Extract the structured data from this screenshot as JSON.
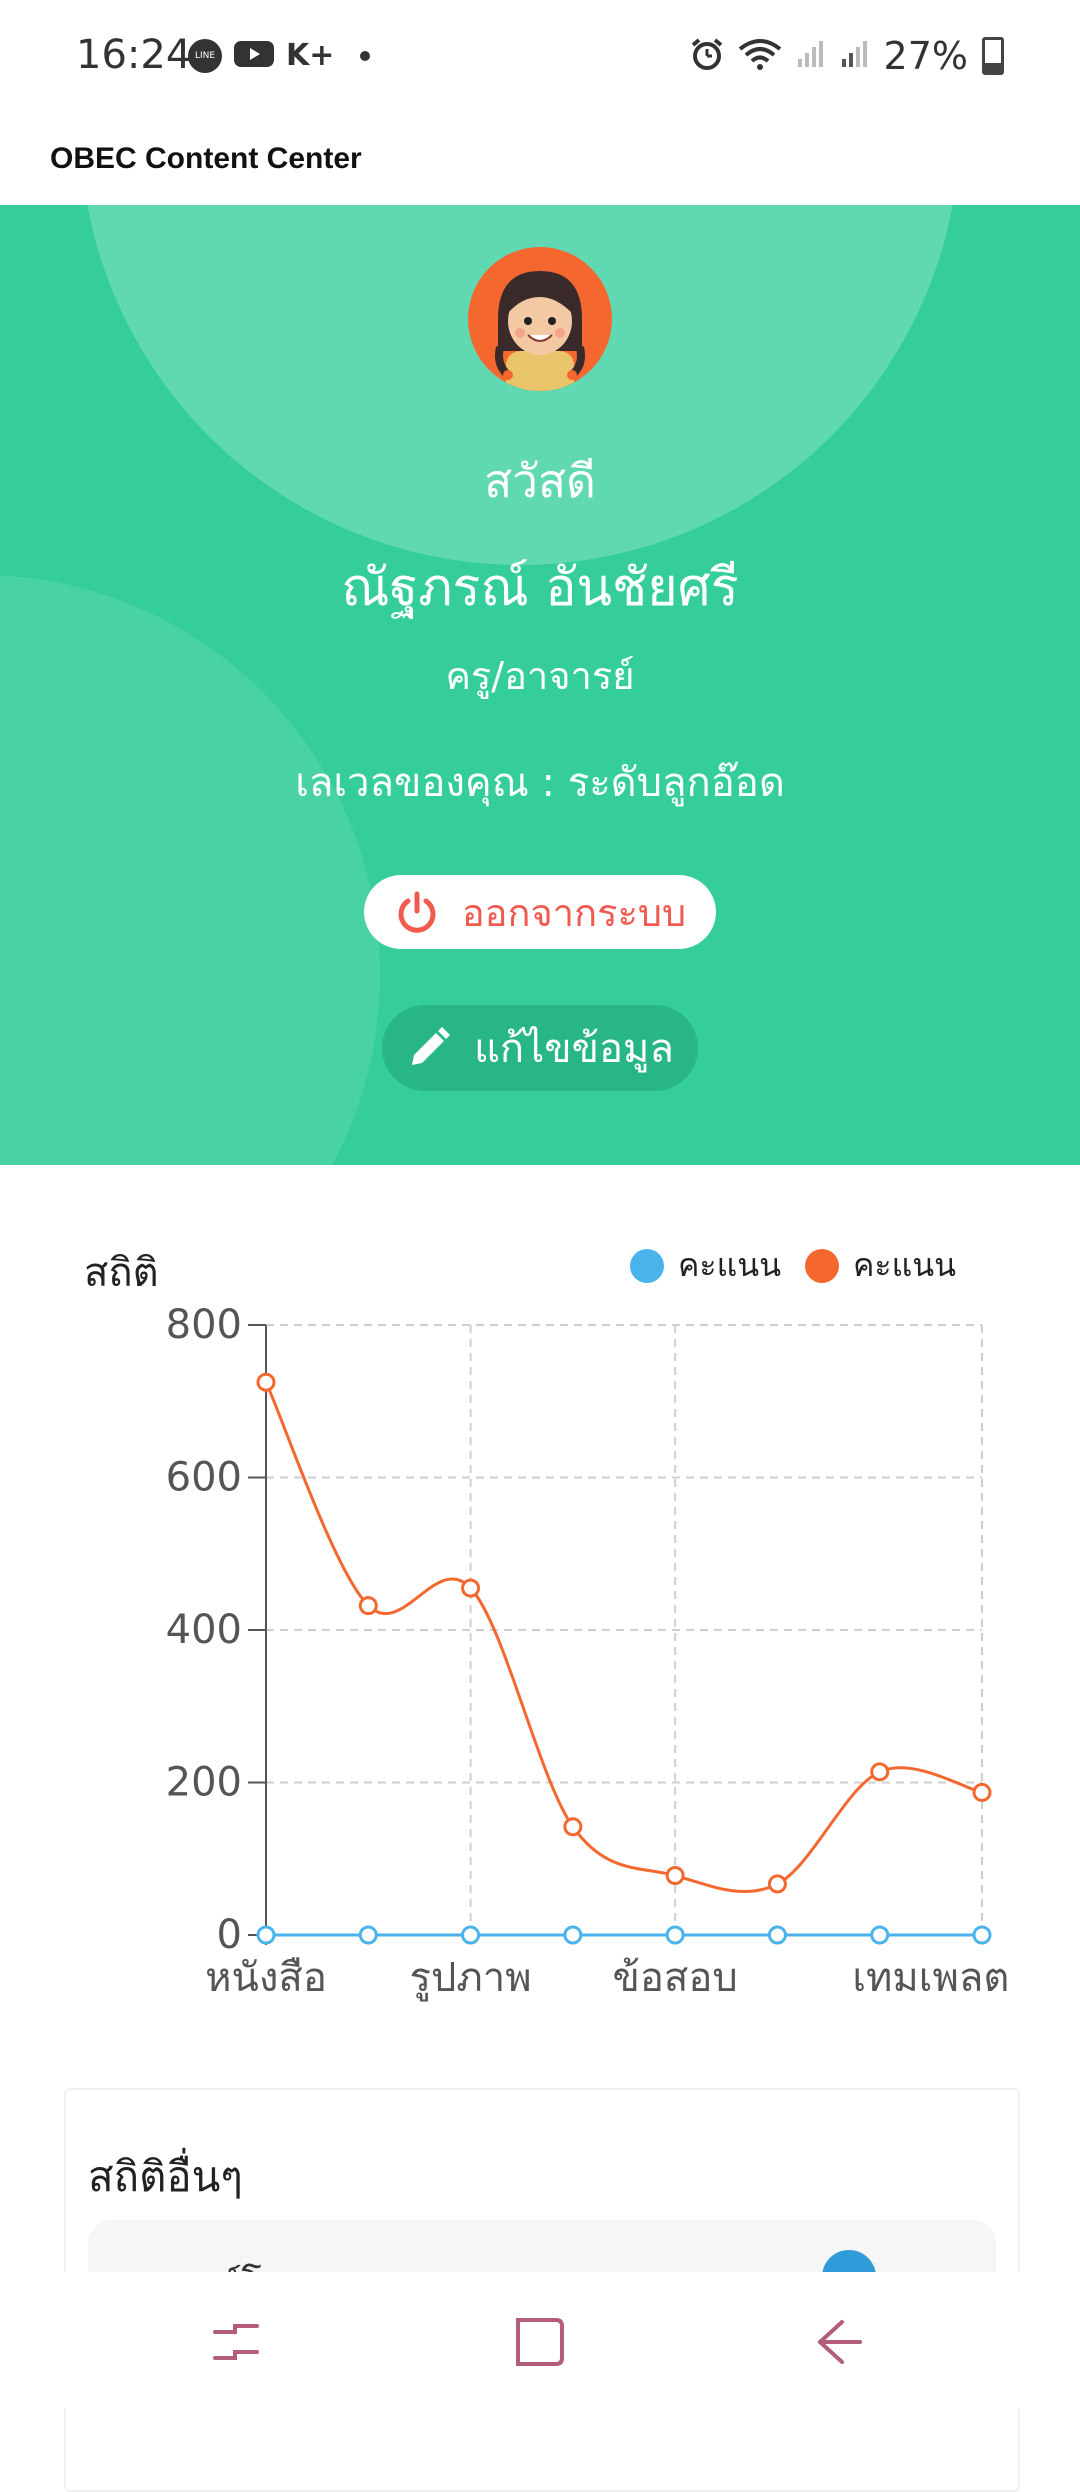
{
  "status_bar": {
    "time": "16:24",
    "notification_icons": [
      "line-icon",
      "youtube-icon",
      "kplus-icon",
      "dot-icon"
    ],
    "kplus_text": "K+",
    "line_text": "LINE",
    "battery": "27%",
    "right_icons": [
      "alarm-icon",
      "wifi-icon",
      "signal-icon",
      "signal-icon",
      "battery-icon"
    ]
  },
  "app_bar": {
    "title": "OBEC Content Center"
  },
  "profile": {
    "greeting": "สวัสดี",
    "name": "ณัฐภรณ์ อันชัยศรี",
    "role": "ครู/อาจารย์",
    "level": "เลเวลของคุณ : ระดับลูกอ๊อด",
    "logout_label": "ออกจากระบบ",
    "edit_label": "แก้ไขข้อมูล"
  },
  "stats": {
    "title": "สถิติ",
    "legend": [
      {
        "label": "คะแนน",
        "color": "#4ab3ec"
      },
      {
        "label": "คะแนน",
        "color": "#f4682f"
      }
    ]
  },
  "chart_data": {
    "type": "line",
    "categories": [
      "หนังสือ",
      "",
      "รูปภาพ",
      "",
      "ข้อสอบ",
      "",
      "เทมเพลต",
      ""
    ],
    "x_tick_labels": [
      "หนังสือ",
      "รูปภาพ",
      "ข้อสอบ",
      "เทมเพลต"
    ],
    "y_ticks": [
      "0",
      "200",
      "400",
      "600",
      "800"
    ],
    "ylim": [
      0,
      800
    ],
    "grid": true,
    "legend_position": "top-right",
    "series": [
      {
        "name": "คะแนน",
        "color": "#4ab3ec",
        "values": [
          0,
          0,
          0,
          0,
          0,
          0,
          0,
          0
        ]
      },
      {
        "name": "คะแนน",
        "color": "#f4682f",
        "values": [
          725,
          432,
          455,
          142,
          78,
          67,
          214,
          187
        ]
      }
    ]
  },
  "other_stats": {
    "title": "สถิติอื่นๆ",
    "first_item_label": "ดาวน์โหลด"
  },
  "nav_bar": {
    "icons": [
      "recent-apps-icon",
      "home-icon",
      "back-icon"
    ]
  }
}
